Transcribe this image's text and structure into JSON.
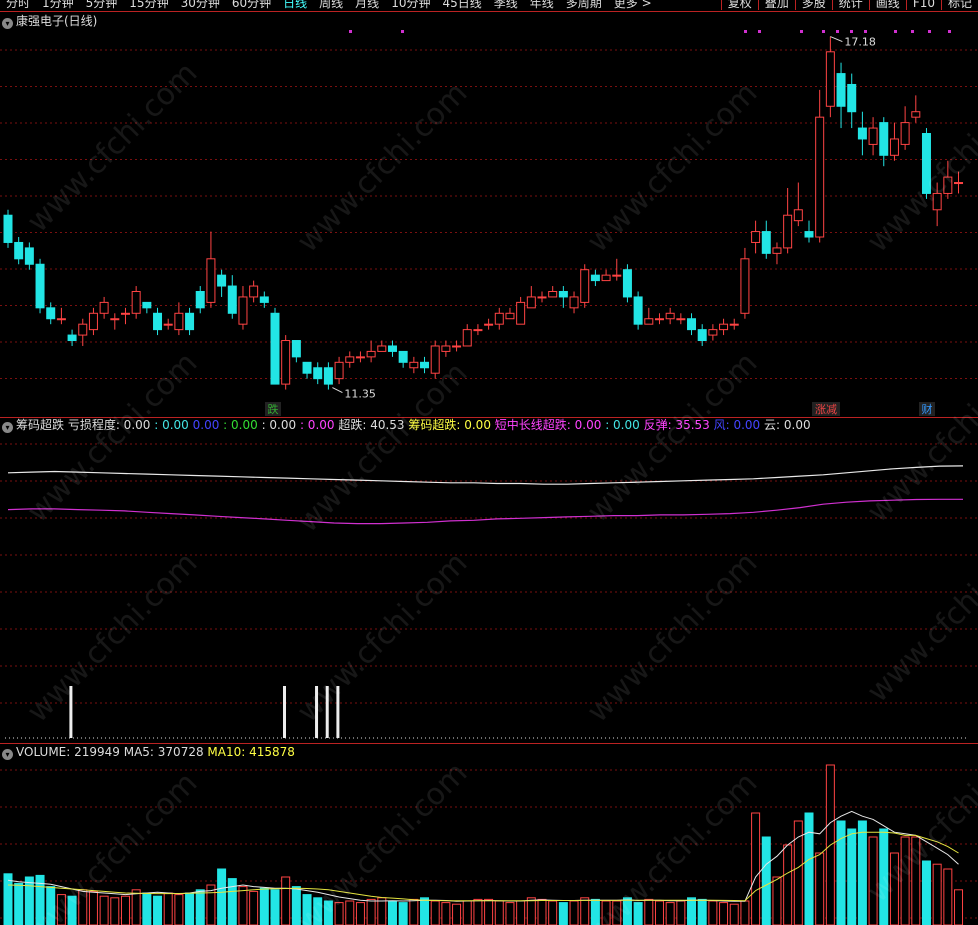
{
  "toolbar": {
    "periods": [
      "分时",
      "1分钟",
      "5分钟",
      "15分钟",
      "30分钟",
      "60分钟",
      "日线",
      "周线",
      "月线",
      "10分钟",
      "45日线",
      "季线",
      "年线",
      "多周期",
      "更多 >"
    ],
    "active_period": "日线",
    "tools": [
      "复权",
      "叠加",
      "多股",
      "统计",
      "画线",
      "F10",
      "标记"
    ]
  },
  "price_panel": {
    "title": "康强电子(日线)",
    "high_label": "17.18",
    "low_label": "11.35",
    "signals": [
      {
        "text": "跌",
        "color": "#3a3"
      },
      {
        "text": "涨减",
        "color": "#e44"
      },
      {
        "text": "财",
        "color": "#39f"
      }
    ],
    "colors": {
      "up": "#ff4444",
      "down": "#22e5e5",
      "grid": "#7a1010"
    },
    "candles": [
      [
        13.9,
        13.4,
        14.0,
        13.3
      ],
      [
        13.4,
        13.1,
        13.5,
        13.0
      ],
      [
        13.3,
        13.0,
        13.4,
        12.9
      ],
      [
        13.0,
        12.2,
        13.1,
        12.1
      ],
      [
        12.2,
        12.0,
        12.3,
        11.9
      ],
      [
        12.0,
        12.0,
        12.2,
        11.9
      ],
      [
        11.7,
        11.6,
        11.8,
        11.5
      ],
      [
        11.7,
        11.9,
        12.0,
        11.5
      ],
      [
        11.8,
        12.1,
        12.2,
        11.7
      ],
      [
        12.1,
        12.3,
        12.4,
        12.0
      ],
      [
        12.0,
        12.0,
        12.1,
        11.8
      ],
      [
        12.1,
        12.1,
        12.2,
        11.9
      ],
      [
        12.1,
        12.5,
        12.6,
        12.0
      ],
      [
        12.3,
        12.2,
        12.3,
        12.1
      ],
      [
        12.1,
        11.8,
        12.2,
        11.7
      ],
      [
        11.9,
        11.9,
        12.0,
        11.8
      ],
      [
        11.8,
        12.1,
        12.3,
        11.7
      ],
      [
        12.1,
        11.8,
        12.2,
        11.7
      ],
      [
        12.5,
        12.2,
        12.6,
        12.1
      ],
      [
        12.3,
        13.1,
        13.6,
        12.2
      ],
      [
        12.8,
        12.6,
        12.9,
        12.4
      ],
      [
        12.6,
        12.1,
        12.8,
        12.0
      ],
      [
        11.9,
        12.4,
        12.6,
        11.8
      ],
      [
        12.4,
        12.6,
        12.7,
        12.3
      ],
      [
        12.4,
        12.3,
        12.5,
        12.2
      ],
      [
        12.1,
        10.8,
        12.2,
        10.8
      ],
      [
        10.8,
        11.6,
        11.7,
        10.7
      ],
      [
        11.6,
        11.3,
        11.6,
        11.2
      ],
      [
        11.2,
        11.0,
        11.2,
        10.9
      ],
      [
        11.1,
        10.9,
        11.2,
        10.8
      ],
      [
        11.1,
        10.8,
        11.2,
        10.7
      ],
      [
        10.9,
        11.2,
        11.3,
        10.8
      ],
      [
        11.2,
        11.3,
        11.4,
        11.1
      ],
      [
        11.3,
        11.3,
        11.4,
        11.2
      ],
      [
        11.3,
        11.4,
        11.6,
        11.2
      ],
      [
        11.4,
        11.5,
        11.6,
        11.4
      ],
      [
        11.5,
        11.4,
        11.6,
        11.3
      ],
      [
        11.4,
        11.2,
        11.4,
        11.1
      ],
      [
        11.1,
        11.2,
        11.3,
        11.0
      ],
      [
        11.2,
        11.1,
        11.3,
        11.0
      ],
      [
        11.0,
        11.5,
        11.6,
        10.9
      ],
      [
        11.4,
        11.5,
        11.6,
        11.3
      ],
      [
        11.5,
        11.5,
        11.6,
        11.4
      ],
      [
        11.5,
        11.8,
        11.9,
        11.5
      ],
      [
        11.8,
        11.8,
        11.9,
        11.7
      ],
      [
        11.9,
        11.9,
        12.0,
        11.8
      ],
      [
        11.9,
        12.1,
        12.2,
        11.8
      ],
      [
        12.0,
        12.1,
        12.2,
        12.0
      ],
      [
        11.9,
        12.3,
        12.4,
        11.9
      ],
      [
        12.2,
        12.4,
        12.6,
        12.2
      ],
      [
        12.4,
        12.4,
        12.5,
        12.3
      ],
      [
        12.4,
        12.5,
        12.6,
        12.4
      ],
      [
        12.5,
        12.4,
        12.6,
        12.2
      ],
      [
        12.2,
        12.4,
        12.5,
        12.1
      ],
      [
        12.3,
        12.9,
        13.0,
        12.2
      ],
      [
        12.8,
        12.7,
        12.9,
        12.6
      ],
      [
        12.7,
        12.8,
        12.9,
        12.7
      ],
      [
        12.8,
        12.8,
        13.1,
        12.7
      ],
      [
        12.9,
        12.4,
        13.0,
        12.3
      ],
      [
        12.4,
        11.9,
        12.5,
        11.8
      ],
      [
        11.9,
        12.0,
        12.2,
        11.9
      ],
      [
        12.0,
        12.0,
        12.1,
        11.9
      ],
      [
        12.0,
        12.1,
        12.2,
        11.9
      ],
      [
        12.0,
        12.0,
        12.1,
        11.9
      ],
      [
        12.0,
        11.8,
        12.1,
        11.7
      ],
      [
        11.8,
        11.6,
        11.9,
        11.5
      ],
      [
        11.7,
        11.8,
        11.9,
        11.6
      ],
      [
        11.8,
        11.9,
        12.0,
        11.7
      ],
      [
        11.9,
        11.9,
        12.0,
        11.8
      ],
      [
        12.1,
        13.1,
        13.3,
        12.0
      ],
      [
        13.4,
        13.6,
        13.8,
        13.2
      ],
      [
        13.6,
        13.2,
        13.8,
        13.1
      ],
      [
        13.2,
        13.3,
        13.4,
        13.0
      ],
      [
        13.3,
        13.9,
        14.4,
        13.2
      ],
      [
        13.8,
        14.0,
        14.5,
        13.7
      ],
      [
        13.6,
        13.5,
        13.8,
        13.4
      ],
      [
        13.5,
        15.7,
        16.2,
        13.4
      ],
      [
        15.9,
        16.9,
        17.18,
        15.7
      ],
      [
        16.5,
        15.9,
        16.7,
        15.5
      ],
      [
        16.3,
        15.8,
        16.5,
        15.5
      ],
      [
        15.5,
        15.3,
        15.8,
        15.0
      ],
      [
        15.2,
        15.5,
        15.7,
        15.0
      ],
      [
        15.6,
        15.0,
        15.7,
        14.8
      ],
      [
        15.0,
        15.3,
        15.6,
        14.9
      ],
      [
        15.2,
        15.6,
        15.9,
        15.1
      ],
      [
        15.7,
        15.8,
        16.1,
        15.6
      ],
      [
        15.4,
        14.3,
        15.5,
        14.2
      ],
      [
        14.0,
        14.3,
        14.5,
        13.7
      ],
      [
        14.3,
        14.6,
        14.9,
        14.2
      ],
      [
        14.5,
        14.5,
        14.7,
        14.3
      ]
    ]
  },
  "indicator_panel": {
    "title_items": [
      {
        "text": "筹码超跌",
        "color": "#dddddd"
      },
      {
        "text": "亏损程度: 0.00",
        "color": "#dddddd"
      },
      {
        "text": ": 0.00",
        "color": "#44e5e5"
      },
      {
        "text": "0.00",
        "color": "#4444ff"
      },
      {
        "text": ": 0.00",
        "color": "#33dd33"
      },
      {
        "text": ": 0.00",
        "color": "#dddddd"
      },
      {
        "text": ": 0.00",
        "color": "#ff44ff"
      },
      {
        "text": "超跌: 40.53",
        "color": "#dddddd"
      },
      {
        "text": "筹码超跌: 0.00",
        "color": "#ffff44"
      },
      {
        "text": "短中长线超跌: 0.00",
        "color": "#ff44ff"
      },
      {
        "text": ": 0.00",
        "color": "#44e5e5"
      },
      {
        "text": "反弹: 35.53",
        "color": "#ff44ff"
      },
      {
        "text": "风: 0.00",
        "color": "#4444ff"
      },
      {
        "text": "云: 0.00",
        "color": "#dddddd"
      }
    ],
    "white_line": [
      39.5,
      39.6,
      39.7,
      39.6,
      39.5,
      39.4,
      39.3,
      39.2,
      39.1,
      39.0,
      38.9,
      38.8,
      38.7,
      38.6,
      38.5,
      38.4,
      38.3,
      38.2,
      38.1,
      38.0,
      38.0,
      37.9,
      37.9,
      37.8,
      37.8,
      37.9,
      38.0,
      38.1,
      38.2,
      38.3,
      38.4,
      38.5,
      38.6,
      38.8,
      39.0,
      39.2,
      39.5,
      39.8,
      40.1,
      40.3,
      40.5,
      40.53
    ],
    "magenta_line": [
      34.0,
      34.1,
      34.1,
      34.0,
      33.9,
      33.8,
      33.6,
      33.4,
      33.2,
      33.0,
      32.8,
      32.6,
      32.4,
      32.2,
      32.0,
      31.9,
      31.9,
      32.0,
      32.1,
      32.3,
      32.4,
      32.6,
      32.7,
      32.8,
      32.9,
      33.0,
      33.1,
      33.1,
      33.2,
      33.2,
      33.3,
      33.4,
      33.6,
      33.9,
      34.3,
      34.8,
      35.1,
      35.3,
      35.4,
      35.5,
      35.53,
      35.53
    ],
    "spikes": [
      5,
      25,
      28,
      29,
      30
    ],
    "colors": {
      "white": "#e8e8e8",
      "magenta": "#d030d0"
    }
  },
  "volume_panel": {
    "title_items": [
      {
        "text": "VOLUME: 219949",
        "color": "#dddddd"
      },
      {
        "text": "MA5: 370728",
        "color": "#dddddd"
      },
      {
        "text": "MA10: 415878",
        "color": "#ffff44"
      }
    ],
    "volumes": [
      320,
      260,
      300,
      310,
      240,
      190,
      180,
      220,
      210,
      180,
      170,
      180,
      220,
      200,
      180,
      200,
      190,
      200,
      220,
      250,
      350,
      290,
      240,
      210,
      230,
      220,
      300,
      240,
      190,
      170,
      150,
      140,
      150,
      140,
      160,
      170,
      150,
      140,
      160,
      170,
      150,
      140,
      130,
      150,
      160,
      160,
      150,
      140,
      150,
      170,
      160,
      150,
      140,
      150,
      170,
      160,
      150,
      150,
      170,
      140,
      160,
      150,
      140,
      150,
      170,
      160,
      150,
      140,
      130,
      150,
      700,
      550,
      300,
      500,
      650,
      700,
      450,
      1000,
      650,
      600,
      650,
      550,
      600,
      450,
      550,
      550,
      400,
      380,
      350,
      220
    ],
    "ma5": [
      280,
      270,
      265,
      260,
      255,
      240,
      225,
      210,
      205,
      200,
      195,
      190,
      195,
      200,
      205,
      200,
      195,
      200,
      210,
      215,
      230,
      240,
      250,
      240,
      235,
      230,
      230,
      225,
      215,
      205,
      190,
      175,
      165,
      155,
      150,
      150,
      152,
      150,
      152,
      155,
      155,
      153,
      148,
      150,
      152,
      153,
      152,
      150,
      150,
      155,
      157,
      155,
      153,
      153,
      155,
      155,
      155,
      155,
      157,
      153,
      155,
      155,
      152,
      152,
      155,
      155,
      153,
      150,
      148,
      148,
      300,
      380,
      430,
      500,
      550,
      580,
      570,
      640,
      680,
      710,
      680,
      660,
      620,
      580,
      570,
      560,
      520,
      480,
      440,
      380
    ],
    "ma10": [
      250,
      248,
      245,
      240,
      235,
      230,
      225,
      220,
      215,
      210,
      205,
      200,
      198,
      197,
      196,
      196,
      197,
      198,
      200,
      202,
      205,
      210,
      215,
      220,
      225,
      226,
      228,
      230,
      228,
      225,
      220,
      210,
      200,
      190,
      180,
      172,
      168,
      163,
      158,
      155,
      153,
      152,
      152,
      151,
      151,
      151,
      151,
      151,
      151,
      152,
      153,
      153,
      153,
      153,
      154,
      154,
      154,
      154,
      155,
      155,
      155,
      155,
      155,
      155,
      155,
      155,
      155,
      154,
      153,
      152,
      215,
      250,
      285,
      325,
      360,
      410,
      440,
      500,
      540,
      570,
      580,
      580,
      580,
      575,
      560,
      560,
      540,
      520,
      490,
      450
    ],
    "colors": {
      "ma5": "#e8e8e8",
      "ma10": "#e5e540"
    }
  },
  "watermark": "www.cfchi.com",
  "top_marks": {
    "color": "#d030d0"
  }
}
